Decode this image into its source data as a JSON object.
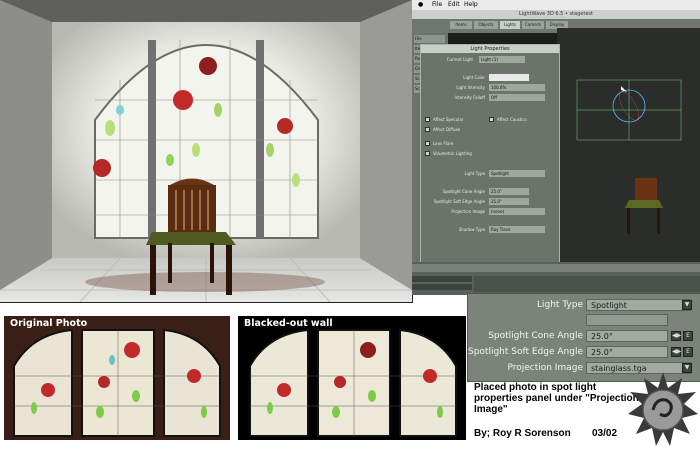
{
  "lightwave": {
    "menu": [
      "File",
      "Edit",
      "Help"
    ],
    "title": "LightWave 3D 6.5 • stagetest",
    "tabs": [
      "Items",
      "Objects",
      "Lights",
      "Camera",
      "Display"
    ],
    "side_buttons": [
      "File",
      "Items",
      "Rendering",
      "Global Illum",
      "Scene Editor",
      "Scene Props"
    ],
    "panel": {
      "title": "Light Properties",
      "current_light_label": "Current Light",
      "current_light": "Light (1)",
      "light_color_label": "Light Color",
      "light_intensity_label": "Light Intensity",
      "light_intensity": "100.0%",
      "intensity_falloff_label": "Intensity Falloff",
      "intensity_falloff": "Off",
      "affect_specular": "Affect Specular",
      "affect_diffuse": "Affect Diffuse",
      "affect_caustics": "Affect Caustics",
      "lens_flare": "Lens Flare",
      "volumetric_lighting": "Volumetric Lighting",
      "light_type_label": "Light Type",
      "light_type": "Spotlight",
      "spotlight_cone_label": "Spotlight Cone Angle",
      "spotlight_cone": "25.0°",
      "soft_edge_label": "Spotlight Soft Edge Angle",
      "soft_edge": "25.0°",
      "projection_label": "Projection Image",
      "projection": "(none)",
      "shadow_type_label": "Shadow Type",
      "shadow_type": "Ray Trace"
    }
  },
  "zoom_panel": {
    "light_type_label": "Light Type",
    "light_type": "Spotlight",
    "cone_label": "Spotlight Cone Angle",
    "cone": "25.0°",
    "soft_edge_label": "Spotlight Soft Edge Angle",
    "soft_edge": "25.0°",
    "projection_label": "Projection Image",
    "projection": "stainglass.tga"
  },
  "photos": {
    "original_label": "Original Photo",
    "blacked_label": "Blacked-out wall"
  },
  "caption": "Placed photo in spot light properties panel under \"Projection Image\"",
  "credit": "By; Roy R Sorenson",
  "date": "03/02",
  "colors": {
    "glass_red": "#c22a2a",
    "glass_green": "#8fd45a",
    "ui_panel": "#6b736b"
  }
}
